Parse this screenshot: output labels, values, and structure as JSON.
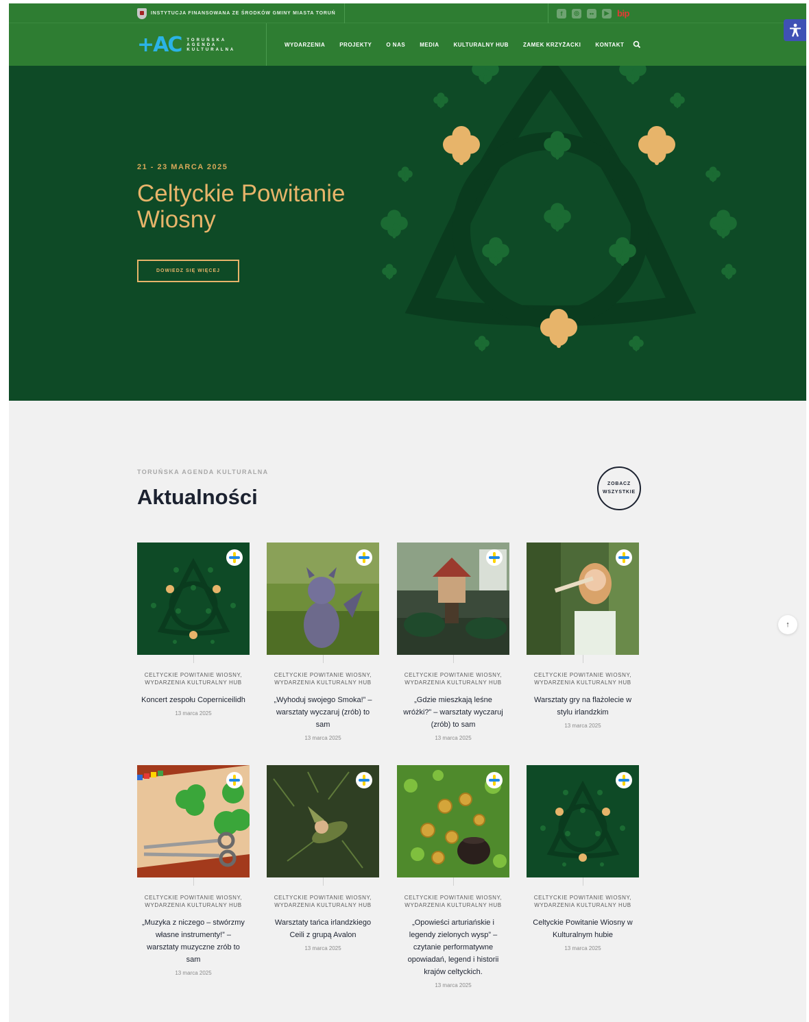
{
  "topbar": {
    "info": "INSTYTUCJA FINANSOWANA ZE ŚRODKÓW GMINY MIASTA TORUŃ",
    "socials": [
      "facebook-icon",
      "instagram-icon",
      "flickr-icon",
      "youtube-icon"
    ],
    "bip": "bip"
  },
  "logo": {
    "mark": "+AC",
    "line1": "TORUŃSKA",
    "line2": "AGENDA",
    "line3": "KULTURALNA"
  },
  "nav": {
    "items": [
      "WYDARZENIA",
      "PROJEKTY",
      "O NAS",
      "MEDIA",
      "KULTURALNY HUB",
      "ZAMEK KRZYŻACKI",
      "KONTAKT"
    ]
  },
  "hero": {
    "date": "21 - 23 MARCA 2025",
    "title": "Celtyckie Powitanie Wiosny",
    "button": "DOWIEDZ SIĘ WIĘCEJ"
  },
  "news": {
    "kicker": "TORUŃSKA AGENDA KULTURALNA",
    "title": "Aktualności",
    "see_all": "ZOBACZ WSZYSTKIE",
    "cards": [
      {
        "cats": "CELTYCKIE POWITANIE WIOSNY, WYDARZENIA KULTURALNY HUB",
        "title": "Koncert zespołu Coperniceilidh",
        "date": "13 marca 2025"
      },
      {
        "cats": "CELTYCKIE POWITANIE WIOSNY, WYDARZENIA KULTURALNY HUB",
        "title": "„Wyhoduj swojego Smoka!” – warsztaty wyczaruj (zrób) to sam",
        "date": "13 marca 2025"
      },
      {
        "cats": "CELTYCKIE POWITANIE WIOSNY, WYDARZENIA KULTURALNY HUB",
        "title": "„Gdzie mieszkają leśne wróżki?” – warsztaty wyczaruj (zrób) to sam",
        "date": "13 marca 2025"
      },
      {
        "cats": "CELTYCKIE POWITANIE WIOSNY, WYDARZENIA KULTURALNY HUB",
        "title": "Warsztaty gry na flażolecie w stylu irlandzkim",
        "date": "13 marca 2025"
      },
      {
        "cats": "CELTYCKIE POWITANIE WIOSNY, WYDARZENIA KULTURALNY HUB",
        "title": "„Muzyka z niczego – stwórzmy własne instrumenty!” – warsztaty muzyczne zrób to sam",
        "date": "13 marca 2025"
      },
      {
        "cats": "CELTYCKIE POWITANIE WIOSNY, WYDARZENIA KULTURALNY HUB",
        "title": "Warsztaty tańca irlandzkiego Ceili z grupą Avalon",
        "date": "13 marca 2025"
      },
      {
        "cats": "CELTYCKIE POWITANIE WIOSNY, WYDARZENIA KULTURALNY HUB",
        "title": "„Opowieści arturiańskie i legendy zielonych wysp” – czytanie performatywne opowiadań, legend i historii krajów celtyckich.",
        "date": "13 marca 2025"
      },
      {
        "cats": "CELTYCKIE POWITANIE WIOSNY, WYDARZENIA KULTURALNY HUB",
        "title": "Celtyckie Powitanie Wiosny w Kulturalnym hubie",
        "date": "13 marca 2025"
      }
    ]
  },
  "colors": {
    "nav_green": "#2e7d32",
    "hero_green": "#0e4a26",
    "gold": "#e7b46a",
    "logo_blue": "#2bb3e6"
  }
}
